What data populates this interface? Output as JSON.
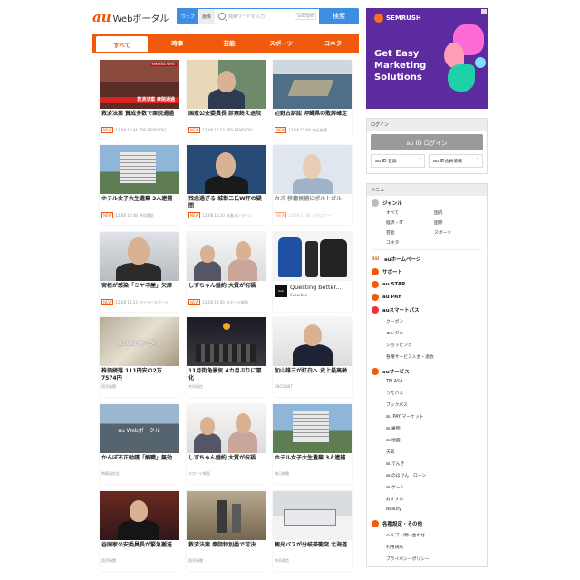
{
  "header": {
    "logo_au": "au",
    "logo_text": "Webポータル",
    "search_toggle": [
      "ウェブ",
      "画像"
    ],
    "search_placeholder": "検索ワードを入力",
    "google_label": "Google",
    "search_button": "検索"
  },
  "tabs": [
    "すべて",
    "時事",
    "芸能",
    "スポーツ",
    "コネタ"
  ],
  "cards": [
    {
      "title": "救済法案 賛成多数で衆院通過",
      "date": "12/08 15:44",
      "source": "TBS NEWS DIG",
      "new": true,
      "overlay": "救済法案 衆院通過",
      "badge": "BREAKING NEWS"
    },
    {
      "title": "国家公安委員長 診察終え退院",
      "date": "12/08 14:53",
      "source": "TBS NEWS DIG",
      "new": true
    },
    {
      "title": "辺野古訴訟 沖縄県の敗訴確定",
      "date": "12/08 15:08",
      "source": "毎日新聞",
      "new": true
    },
    {
      "title": "ホテル女子大生遺棄 3人逮捕",
      "date": "12/08 12:48",
      "source": "共同通信",
      "new": true
    },
    {
      "title": "残念過ぎる 城彰二氏W杯の疑問",
      "date": "12/08 11:10",
      "source": "文春オンライン",
      "new": true
    },
    {
      "title": "カズ 移籍候補にポルトガル",
      "date": "12/08 11:08",
      "source": "日刊スポーツ",
      "new": true,
      "faded": true
    },
    {
      "title": "宮根が感染「ミヤネ屋」欠席",
      "date": "12/08 14:13",
      "source": "デイリースポーツ",
      "new": true
    },
    {
      "title": "しずちゃん婚約 大質が祝福",
      "date": "12/08 13:30",
      "source": "スポーツ報知",
      "new": true
    },
    {
      "title": "Questing better...",
      "source": "Subarban",
      "ad": true
    },
    {
      "title": "株価続落 111円安の2万7574円",
      "source": "読売新聞",
      "watermark": "au Webポータル"
    },
    {
      "title": "11月街角景気 4カ月ぶりに悪化",
      "source": "共同通信"
    },
    {
      "title": "加山雄三が紅白へ 史上最高齢",
      "source": "ENCOUNT"
    },
    {
      "title": "かんぽ不正勧誘「解職」無効",
      "source": "時事通信社",
      "watermark": "au Webポータル"
    },
    {
      "title": "しずちゃん婚約 大質が祝福",
      "source": "スポーツ報知"
    },
    {
      "title": "ホテル女子大生遺棄 3人逮捕",
      "source": "毎日新聞"
    },
    {
      "title": "谷国家公安委員長が緊急搬送",
      "source": "読売新聞"
    },
    {
      "title": "救済法案 衆院特別委で可決",
      "source": "読売新聞"
    },
    {
      "title": "観光バスが分岐帯衝突 北海道",
      "source": "共同通信"
    }
  ],
  "banner": {
    "brand": "SEMRUSH",
    "line1": "Get Easy",
    "line2": "Marketing",
    "line3": "Solutions",
    "colors": {
      "bg": "#5b2b9f",
      "cta": "#ff6b23"
    }
  },
  "login": {
    "heading": "ログイン",
    "button": "au ID ログイン",
    "register": "au ID 登録",
    "member_info": "au ID会員情報"
  },
  "menu": {
    "heading": "メニュー",
    "genre_title": "ジャンル",
    "genres": [
      "すべて",
      "国内",
      "経済・IT",
      "国際",
      "芸能",
      "スポーツ",
      "コネタ"
    ],
    "sections": [
      {
        "icon": "au-icon",
        "label": "auホームページ"
      },
      {
        "icon": "support-icon",
        "label": "サポート"
      },
      {
        "icon": "star-icon",
        "label": "au STAR"
      },
      {
        "icon": "pay-icon",
        "label": "au PAY"
      },
      {
        "icon": "smartpass-icon",
        "label": "auスマートパス",
        "items": [
          "クーポン",
          "エンタメ",
          "ショッピング",
          "各種サービス入会・退会"
        ]
      },
      {
        "icon": "service-icon",
        "label": "auサービス",
        "items": [
          "TELASA",
          "うたパス",
          "ブックパス",
          "au PAY マーケット",
          "au果物",
          "au地図",
          "天気",
          "auでんき",
          "auのほけん・ローン",
          "auゲーム",
          "おすすめ",
          "Beauty"
        ]
      },
      {
        "icon": "settings-icon",
        "label": "各種設定・その他",
        "items": [
          "ヘルプ・問い合わせ",
          "利用規約",
          "プライバシーポリシー"
        ]
      }
    ]
  }
}
